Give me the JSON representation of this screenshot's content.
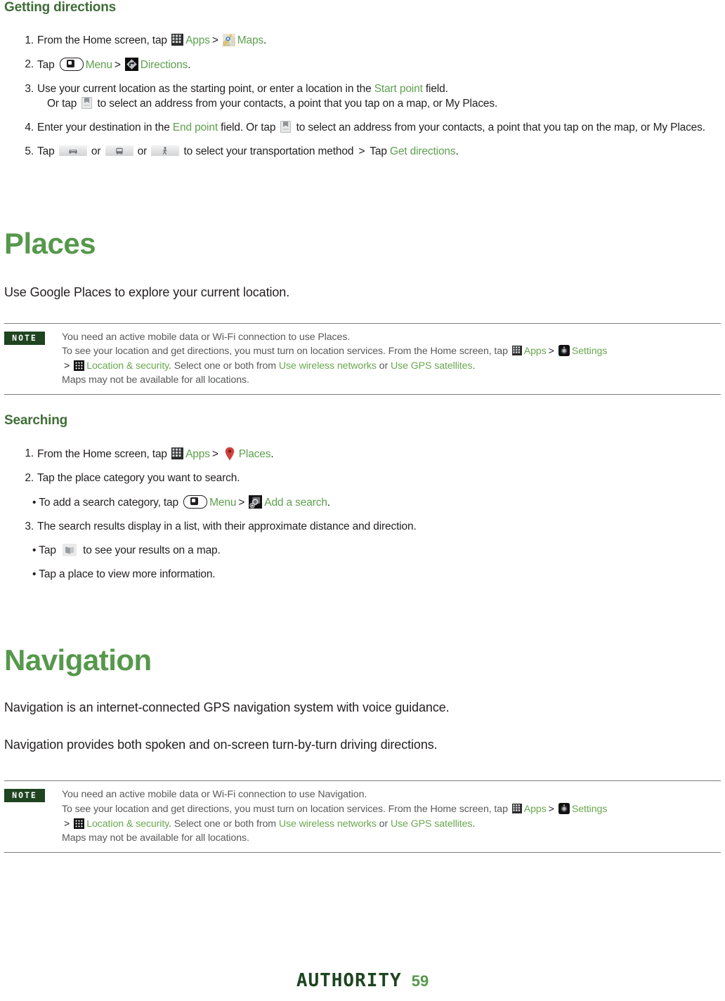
{
  "sections": {
    "getting_directions": {
      "heading": "Getting directions",
      "steps": [
        {
          "num": "1.",
          "parts": [
            {
              "t": "text",
              "v": "From the Home screen, tap "
            },
            {
              "t": "icon",
              "v": "apps-icon"
            },
            {
              "t": "green",
              "v": "Apps"
            },
            {
              "t": "gt",
              "v": ">"
            },
            {
              "t": "icon",
              "v": "maps-icon"
            },
            {
              "t": "green",
              "v": "Maps"
            },
            {
              "t": "text",
              "v": "."
            }
          ]
        },
        {
          "num": "2.",
          "parts": [
            {
              "t": "text",
              "v": "Tap "
            },
            {
              "t": "icon",
              "v": "menu-key-icon"
            },
            {
              "t": "green",
              "v": "Menu"
            },
            {
              "t": "gt",
              "v": ">"
            },
            {
              "t": "icon",
              "v": "directions-icon"
            },
            {
              "t": "green",
              "v": "Directions"
            },
            {
              "t": "text",
              "v": "."
            }
          ]
        },
        {
          "num": "3.",
          "parts": [
            {
              "t": "text",
              "v": "Use your current location as the starting point, or enter a location in the "
            },
            {
              "t": "green",
              "v": "Start point"
            },
            {
              "t": "text",
              "v": " field."
            },
            {
              "t": "br",
              "v": ""
            },
            {
              "t": "text",
              "v": "Or tap "
            },
            {
              "t": "icon",
              "v": "contacts-book-icon"
            },
            {
              "t": "text",
              "v": " to select an address from your contacts, a point that you tap on a map, or My Places."
            }
          ]
        },
        {
          "num": "4.",
          "parts": [
            {
              "t": "text",
              "v": "Enter your destination in the "
            },
            {
              "t": "green",
              "v": "End point"
            },
            {
              "t": "text",
              "v": " field. Or tap "
            },
            {
              "t": "icon",
              "v": "contacts-book-icon"
            },
            {
              "t": "text",
              "v": " to select an address from your contacts, a point that you tap on the map, or My Places."
            }
          ]
        },
        {
          "num": "5.",
          "parts": [
            {
              "t": "text",
              "v": "Tap "
            },
            {
              "t": "icon",
              "v": "transport-car-icon"
            },
            {
              "t": "text",
              "v": " or "
            },
            {
              "t": "icon",
              "v": "transport-transit-icon"
            },
            {
              "t": "text",
              "v": " or "
            },
            {
              "t": "icon",
              "v": "transport-walk-icon"
            },
            {
              "t": "text",
              "v": " to select your transportation method "
            },
            {
              "t": "gt",
              "v": ">"
            },
            {
              "t": "text",
              "v": " Tap "
            },
            {
              "t": "green",
              "v": "Get directions"
            },
            {
              "t": "text",
              "v": "."
            }
          ]
        }
      ]
    },
    "places": {
      "heading": "Places",
      "intro": "Use Google Places to explore your current location.",
      "note": {
        "badge": "NOTE",
        "line1": "You need an active mobile data or Wi-Fi connection to use Places.",
        "line2_a": "To see your location and get directions, you must turn on location services. From the Home screen, tap ",
        "line2_apps": "Apps",
        "line2_settings": "Settings",
        "line3_locsec": "Location & security",
        "line3_b": ". Select one or both from ",
        "line3_wifi": "Use wireless networks",
        "line3_or": " or ",
        "line3_gps": "Use GPS satellites",
        "line3_end": ".",
        "line4": "Maps may not be available for all locations."
      }
    },
    "searching": {
      "heading": "Searching",
      "steps": [
        {
          "num": "1.",
          "parts": [
            {
              "t": "text",
              "v": "From the Home screen, tap "
            },
            {
              "t": "icon",
              "v": "apps-icon"
            },
            {
              "t": "green",
              "v": "Apps"
            },
            {
              "t": "gt",
              "v": ">"
            },
            {
              "t": "icon",
              "v": "places-pin-icon"
            },
            {
              "t": "green",
              "v": "Places"
            },
            {
              "t": "text",
              "v": "."
            }
          ]
        },
        {
          "num": "2.",
          "parts": [
            {
              "t": "text",
              "v": "Tap the place category you want to search."
            }
          ]
        },
        {
          "num": "3.",
          "parts": [
            {
              "t": "text",
              "v": "The search results display in a list, with their approximate distance and direction."
            }
          ]
        }
      ],
      "bullets": [
        {
          "after_step": 2,
          "parts": [
            {
              "t": "text",
              "v": "To add a search category, tap "
            },
            {
              "t": "icon",
              "v": "menu-key-icon"
            },
            {
              "t": "green",
              "v": "Menu"
            },
            {
              "t": "gt",
              "v": ">"
            },
            {
              "t": "icon",
              "v": "add-search-icon"
            },
            {
              "t": "green",
              "v": "Add a search"
            },
            {
              "t": "text",
              "v": "."
            }
          ]
        },
        {
          "after_step": 3,
          "parts": [
            {
              "t": "text",
              "v": "Tap "
            },
            {
              "t": "icon",
              "v": "map-fold-icon"
            },
            {
              "t": "text",
              "v": " to see your results on a map."
            }
          ]
        },
        {
          "after_step": 3,
          "parts": [
            {
              "t": "text",
              "v": "Tap a place to view more information."
            }
          ]
        }
      ]
    },
    "navigation": {
      "heading": "Navigation",
      "intro1": "Navigation is an internet-connected GPS navigation system with voice guidance.",
      "intro2": "Navigation provides both spoken and on-screen turn-by-turn driving directions.",
      "note": {
        "badge": "NOTE",
        "line1": "You need an active mobile data or Wi-Fi connection to use Navigation.",
        "line2_a": "To see your location and get directions, you must turn on location services. From the Home screen, tap ",
        "line2_apps": "Apps",
        "line2_settings": "Settings",
        "line3_locsec": "Location & security",
        "line3_b": ". Select one or both from ",
        "line3_wifi": "Use wireless networks",
        "line3_or": " or ",
        "line3_gps": "Use GPS satellites",
        "line3_end": ".",
        "line4": "Maps may not be available for all locations."
      }
    }
  },
  "footer": {
    "brand": "AUTHORITY",
    "page_number": "59"
  },
  "colors": {
    "heading_dark_green": "#3f6d38",
    "heading_light_green": "#56984c",
    "link_green": "#5ea04f",
    "note_green": "#6aa84f",
    "note_badge_bg": "#1e4420",
    "body_text": "#231f20",
    "note_text": "#58595b",
    "rule": "#7d7d7d"
  }
}
